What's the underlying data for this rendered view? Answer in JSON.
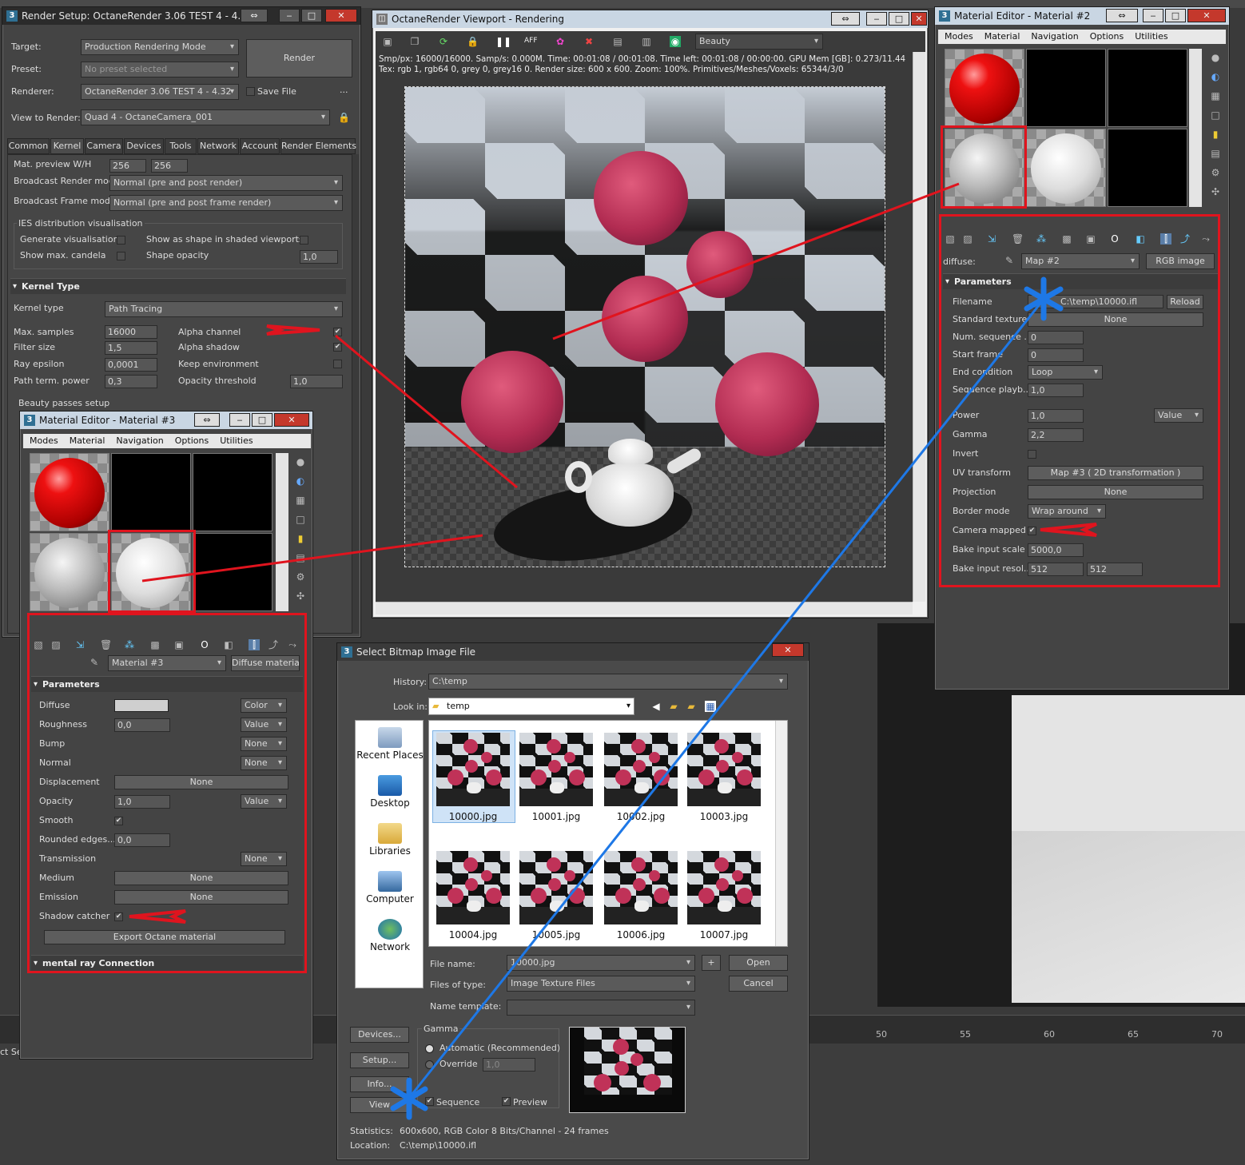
{
  "colors": {
    "accent_red": "#e0141e",
    "accent_blue": "#1e78e6"
  },
  "render_setup": {
    "title": "Render Setup: OctaneRender 3.06 TEST 4 - 4.32",
    "target_label": "Target:",
    "target_value": "Production Rendering Mode",
    "preset_label": "Preset:",
    "preset_value": "No preset selected",
    "renderer_label": "Renderer:",
    "renderer_value": "OctaneRender 3.06 TEST 4 - 4.32",
    "save_file": "Save File",
    "more": "...",
    "view_label": "View to Render:",
    "view_value": "Quad 4 - OctaneCamera_001",
    "render_button": "Render",
    "tabs": [
      "Common",
      "Kernel",
      "Camera",
      "Devices",
      "Tools",
      "Network",
      "Account",
      "Render Elements"
    ],
    "mat_preview_label": "Mat. preview W/H",
    "mat_preview_w": "256",
    "mat_preview_h": "256",
    "broadcast_render_label": "Broadcast Render mode",
    "broadcast_render_value": "Normal (pre and post render)",
    "broadcast_frame_label": "Broadcast Frame mode",
    "broadcast_frame_value": "Normal (pre and post frame render)",
    "ies_group": "IES distribution visualisation",
    "gen_vis": "Generate visualisation",
    "show_shape": "Show as shape in shaded viewports",
    "show_candela": "Show max. candela",
    "shape_opacity": "Shape opacity",
    "shape_opacity_value": "1,0",
    "kernel_section": "Kernel Type",
    "kernel_type_label": "Kernel type",
    "kernel_type_value": "Path Tracing",
    "max_samples_label": "Max. samples",
    "max_samples_value": "16000",
    "filter_label": "Filter size",
    "filter_value": "1,5",
    "ray_eps_label": "Ray epsilon",
    "ray_eps_value": "0,0001",
    "path_term_label": "Path term. power",
    "path_term_value": "0,3",
    "alpha_channel": "Alpha channel",
    "alpha_shadow": "Alpha shadow",
    "keep_env": "Keep environment",
    "opacity_thr_label": "Opacity threshold",
    "opacity_thr_value": "1,0",
    "beauty_passes": "Beauty passes setup"
  },
  "viewport": {
    "title": "OctaneRender Viewport - Rendering",
    "pass_value": "Beauty",
    "stats_line1": "Smp/px: 16000/16000.   Samp/s: 0.000M.   Time: 00:01:08 / 00:01:08.   Time left: 00:01:08 / 00:00:00.   GPU Mem [GB]: 0.273/11.44",
    "stats_line2": "Tex: rgb 1, rgb64 0, grey 0, grey16 0.   Render size: 600 x 600.   Zoom: 100%.   Primitives/Meshes/Voxels: 65344/3/0",
    "toolbar_aff": "AFF"
  },
  "mat2": {
    "title": "Material Editor - Material #2",
    "menu": [
      "Modes",
      "Material",
      "Navigation",
      "Options",
      "Utilities"
    ],
    "diffuse_label": "diffuse:",
    "map_value": "Map #2",
    "map_type": "RGB image",
    "section": "Parameters",
    "filename_label": "Filename",
    "filename_value": "C:\\temp\\10000.ifl",
    "reload": "Reload",
    "std_tex_label": "Standard texture",
    "std_tex_value": "None",
    "num_seq_label": "Num. sequence ...",
    "num_seq_value": "0",
    "start_frame_label": "Start frame",
    "start_frame_value": "0",
    "end_cond_label": "End condition",
    "end_cond_value": "Loop",
    "seq_play_label": "Sequence playb...",
    "seq_play_value": "1,0",
    "power_label": "Power",
    "power_value": "1,0",
    "power_mode": "Value",
    "gamma_label": "Gamma",
    "gamma_value": "2,2",
    "invert_label": "Invert",
    "uv_label": "UV transform",
    "uv_value": "Map #3  ( 2D transformation )",
    "proj_label": "Projection",
    "proj_value": "None",
    "border_label": "Border mode",
    "border_value": "Wrap around",
    "cam_mapped_label": "Camera mapped",
    "bake_scale_label": "Bake input scale",
    "bake_scale_value": "5000,0",
    "bake_res_label": "Bake input resol...",
    "bake_res_w": "512",
    "bake_res_h": "512"
  },
  "mat3": {
    "title": "Material Editor - Material #3",
    "menu": [
      "Modes",
      "Material",
      "Navigation",
      "Options",
      "Utilities"
    ],
    "mat_value": "Material #3",
    "mat_type": "Diffuse material",
    "section": "Parameters",
    "diffuse_label": "Diffuse",
    "diffuse_mode": "Color",
    "rough_label": "Roughness",
    "rough_value": "0,0",
    "rough_mode": "Value",
    "bump_label": "Bump",
    "bump_mode": "None",
    "normal_label": "Normal",
    "normal_mode": "None",
    "disp_label": "Displacement",
    "disp_value": "None",
    "opacity_label": "Opacity",
    "opacity_value": "1,0",
    "opacity_mode": "Value",
    "smooth_label": "Smooth",
    "rounded_label": "Rounded edges...",
    "rounded_value": "0,0",
    "trans_label": "Transmission",
    "trans_mode": "None",
    "medium_label": "Medium",
    "medium_value": "None",
    "emission_label": "Emission",
    "emission_value": "None",
    "shadow_label": "Shadow catcher",
    "export_button": "Export Octane material",
    "mental_ray": "mental ray Connection"
  },
  "bitmap": {
    "title": "Select Bitmap Image File",
    "history_label": "History:",
    "history_value": "C:\\temp",
    "lookin_label": "Look in:",
    "lookin_value": "temp",
    "places": [
      "Recent Places",
      "Desktop",
      "Libraries",
      "Computer",
      "Network"
    ],
    "files": [
      "10000.jpg",
      "10001.jpg",
      "10002.jpg",
      "10003.jpg",
      "10004.jpg",
      "10005.jpg",
      "10006.jpg",
      "10007.jpg"
    ],
    "filename_label": "File name:",
    "filename_value": "10000.jpg",
    "filetype_label": "Files of type:",
    "filetype_value": "Image Texture Files",
    "template_label": "Name template:",
    "open": "Open",
    "cancel": "Cancel",
    "devices": "Devices...",
    "setup": "Setup...",
    "info": "Info...",
    "view": "View",
    "gamma_group": "Gamma",
    "gamma_auto": "Automatic (Recommended)",
    "gamma_override": "Override",
    "gamma_override_value": "1,0",
    "sequence": "Sequence",
    "preview": "Preview",
    "stats_label": "Statistics:",
    "stats_value": "600x600, RGB Color 8 Bits/Channel - 24 frames",
    "location_label": "Location:",
    "location_value": "C:\\temp\\10000.ifl"
  },
  "background": {
    "ruler": [
      "50",
      "55",
      "60",
      "65",
      "70"
    ],
    "status_left": "ct Se"
  }
}
